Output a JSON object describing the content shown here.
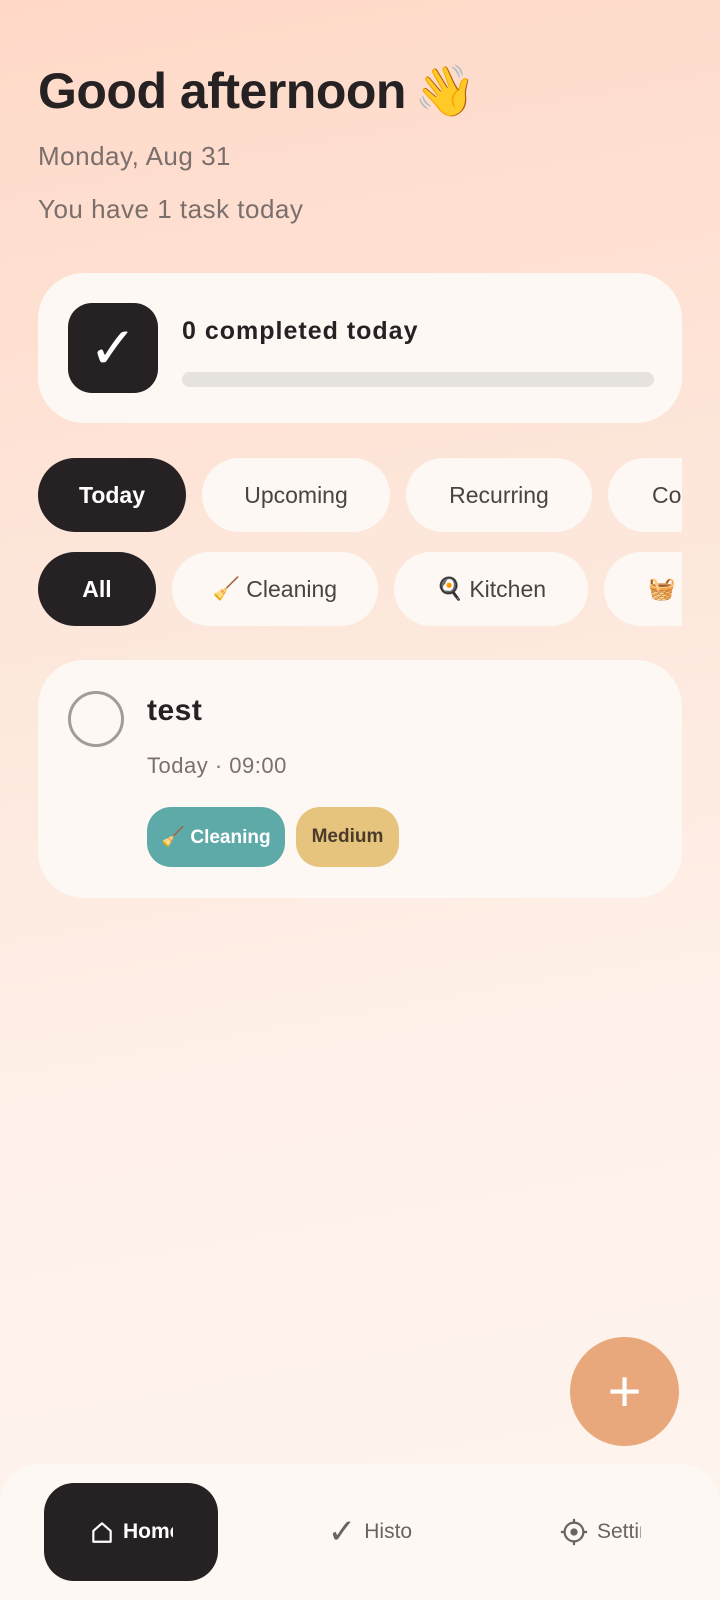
{
  "header": {
    "greeting": "Good afternoon",
    "greeting_emoji": "👋",
    "date": "Monday, Aug 31",
    "summary": "You have 1 task today"
  },
  "progress": {
    "icon": "check-icon",
    "check_glyph": "✓",
    "label": "0 completed today",
    "completed_fraction": 0,
    "fill_color": "#e8a87c"
  },
  "view_tabs": [
    {
      "label": "Today",
      "active": true
    },
    {
      "label": "Upcoming",
      "active": false
    },
    {
      "label": "Recurring",
      "active": false
    },
    {
      "label": "Co",
      "active": false
    }
  ],
  "category_filters": [
    {
      "emoji": "",
      "label": "All",
      "active": true
    },
    {
      "emoji": "🧹",
      "label": "Cleaning",
      "active": false
    },
    {
      "emoji": "🍳",
      "label": "Kitchen",
      "active": false
    },
    {
      "emoji": "🧺",
      "label": "",
      "active": false
    }
  ],
  "task": {
    "title": "test",
    "meta": "Today · 09:00",
    "category_tag": "🧹 Cleaning",
    "category_color": "#5eaaa8",
    "priority_tag": "Medium",
    "priority_color": "#e6c47d"
  },
  "fab": {
    "glyph": "+",
    "icon": "plus-icon"
  },
  "bottom_nav": {
    "home": {
      "label": "Home",
      "icon": "home-icon",
      "active": true
    },
    "history": {
      "label": "History",
      "icon": "check-icon",
      "active": false
    },
    "settings": {
      "label": "Settings",
      "icon": "gear-icon",
      "active": false
    }
  }
}
